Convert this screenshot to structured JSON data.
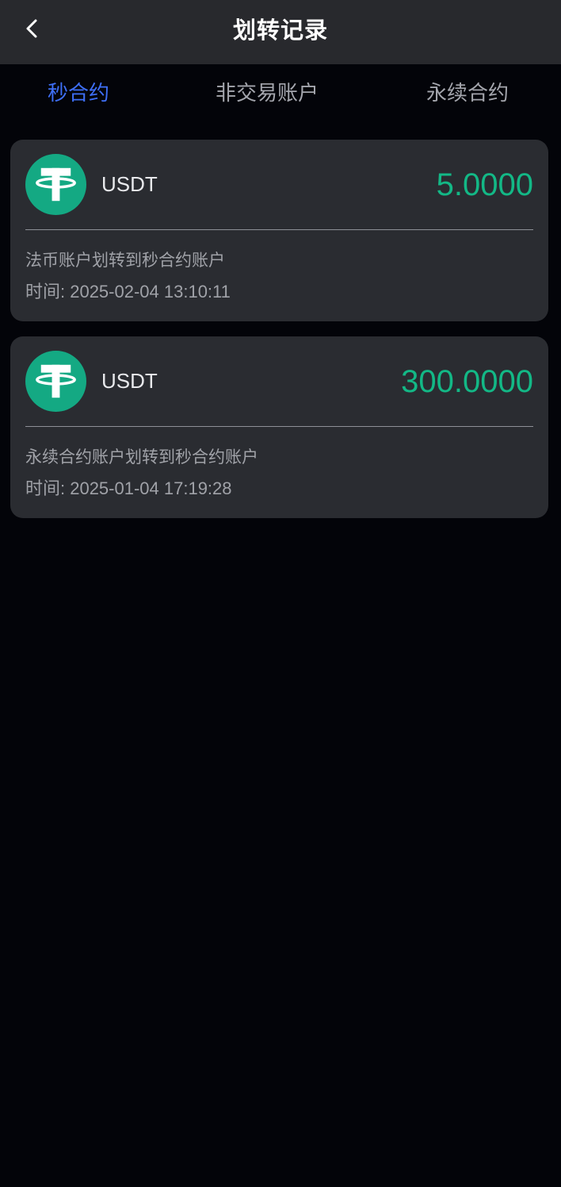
{
  "header": {
    "title": "划转记录",
    "back_icon": "chevron-left-icon"
  },
  "tabs": [
    {
      "label": "秒合约",
      "active": true
    },
    {
      "label": "非交易账户",
      "active": false
    },
    {
      "label": "永续合约",
      "active": false
    }
  ],
  "colors": {
    "accent": "#3e6ff6",
    "amount_green": "#13b886",
    "usdt_logo": "#14a983",
    "card_bg": "#2a2c31",
    "header_bg": "#28292d",
    "page_bg": "#030409"
  },
  "records": [
    {
      "coin": "USDT",
      "coin_icon": "tether-usdt-icon",
      "amount": "5.0000",
      "description": "法币账户划转到秒合约账户",
      "time": "时间: 2025-02-04 13:10:11"
    },
    {
      "coin": "USDT",
      "coin_icon": "tether-usdt-icon",
      "amount": "300.0000",
      "description": "永续合约账户划转到秒合约账户",
      "time": "时间: 2025-01-04 17:19:28"
    }
  ]
}
